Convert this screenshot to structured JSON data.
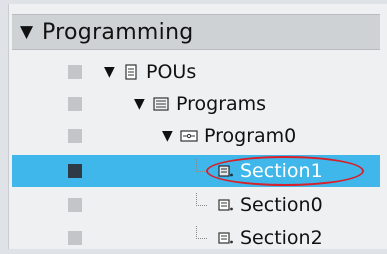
{
  "header": {
    "title": "Programming",
    "expand_glyph": "▼"
  },
  "tree": [
    {
      "label": "POUs",
      "icon": "pous-icon",
      "expanded": true,
      "glyph": "▼"
    },
    {
      "label": "Programs",
      "icon": "programs-folder-icon",
      "expanded": true,
      "glyph": "▼"
    },
    {
      "label": "Program0",
      "icon": "program-icon",
      "expanded": true,
      "glyph": "▼"
    },
    {
      "label": "Section1",
      "icon": "section-icon",
      "selected": true
    },
    {
      "label": "Section0",
      "icon": "section-icon"
    },
    {
      "label": "Section2",
      "icon": "section-icon"
    }
  ],
  "colors": {
    "selection": "#3fb7ea",
    "highlight_ring": "#d8202a"
  }
}
